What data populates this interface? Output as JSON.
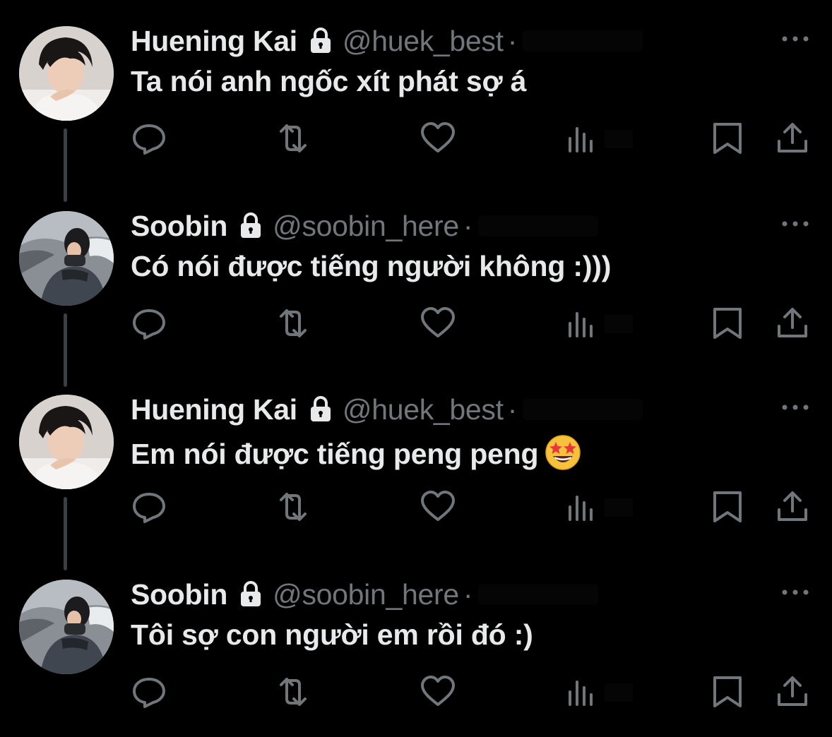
{
  "tweets": [
    {
      "display_name": "Huening Kai",
      "handle": "@huek_best",
      "separator": "·",
      "text": "Ta nói anh ngốc xít phát sợ á",
      "avatar": "avatar-huening-kai",
      "emoji": null
    },
    {
      "display_name": "Soobin",
      "handle": "@soobin_here",
      "separator": "·",
      "text": "Có nói được tiếng người không :)))",
      "avatar": "avatar-soobin",
      "emoji": null
    },
    {
      "display_name": "Huening Kai",
      "handle": "@huek_best",
      "separator": "·",
      "text": "Em nói được tiếng peng peng",
      "avatar": "avatar-huening-kai",
      "emoji": "star-struck-emoji"
    },
    {
      "display_name": "Soobin",
      "handle": "@soobin_here",
      "separator": "·",
      "text": "Tôi sợ con người em rồi đó :)",
      "avatar": "avatar-soobin",
      "emoji": null
    }
  ],
  "icons": {
    "lock": "lock-icon",
    "more": "more-icon",
    "reply": "reply-icon",
    "retweet": "retweet-icon",
    "like": "heart-icon",
    "views": "views-icon",
    "bookmark": "bookmark-icon",
    "share": "share-icon"
  },
  "colors": {
    "background": "#000000",
    "primary_text": "#e7e9ea",
    "secondary_text": "#71767b",
    "thread_line": "#3b3f44"
  }
}
